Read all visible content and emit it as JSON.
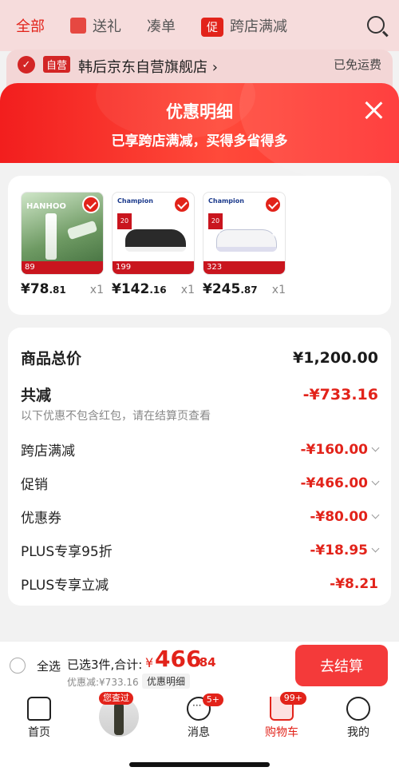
{
  "background": {
    "tabs": [
      "全部",
      "送礼",
      "凑单",
      "跨店满减"
    ],
    "cross_badge": "促",
    "store_tag": "自营",
    "store_name": "韩后京东自营旗舰店 ›",
    "shipping": "已免运费"
  },
  "sheet": {
    "title": "优惠明细",
    "subtitle": "已享跨店满减，买得多省得多"
  },
  "products": [
    {
      "price_int": "¥78",
      "price_dec": ".81",
      "qty": "x1",
      "image": "skincare-product",
      "strip": "89"
    },
    {
      "price_int": "¥142",
      "price_dec": ".16",
      "qty": "x1",
      "image": "black-sneaker",
      "strip": "199",
      "promo": "20",
      "brand": "Champion"
    },
    {
      "price_int": "¥245",
      "price_dec": ".87",
      "qty": "x1",
      "image": "white-sneaker",
      "strip": "323",
      "promo": "20",
      "brand": "Champion"
    }
  ],
  "summary": {
    "total_label": "商品总价",
    "total_value": "¥1,200.00",
    "reduction_label": "共减",
    "reduction_value": "-¥733.16",
    "note": "以下优惠不包含红包，请在结算页查看",
    "items": [
      {
        "label": "跨店满减",
        "value": "-¥160.00",
        "expandable": true
      },
      {
        "label": "促销",
        "value": "-¥466.00",
        "expandable": true
      },
      {
        "label": "优惠券",
        "value": "-¥80.00",
        "expandable": true
      },
      {
        "label": "PLUS专享95折",
        "value": "-¥18.95",
        "expandable": true
      },
      {
        "label": "PLUS专享立减",
        "value": "-¥8.21",
        "expandable": false
      }
    ]
  },
  "checkout": {
    "select_all": "全选",
    "selected_text": "已选3件,合计:",
    "currency": "¥",
    "total_int": "466",
    "total_dec": ".84",
    "discount_text": "优惠减:¥733.16",
    "detail_chip": "优惠明细",
    "pay_button": "去结算"
  },
  "tabbar": {
    "items": [
      {
        "label": "首页",
        "icon": "home-icon"
      },
      {
        "label": "",
        "icon": "recently-viewed-avatar",
        "badge": "您查过"
      },
      {
        "label": "消息",
        "icon": "message-icon",
        "badge": "5+"
      },
      {
        "label": "购物车",
        "icon": "cart-icon",
        "badge": "99+",
        "active": true
      },
      {
        "label": "我的",
        "icon": "profile-icon"
      }
    ]
  },
  "colors": {
    "accent": "#e2231a",
    "header_gradient_start": "#f21e1e",
    "button": "#f43a3a"
  }
}
